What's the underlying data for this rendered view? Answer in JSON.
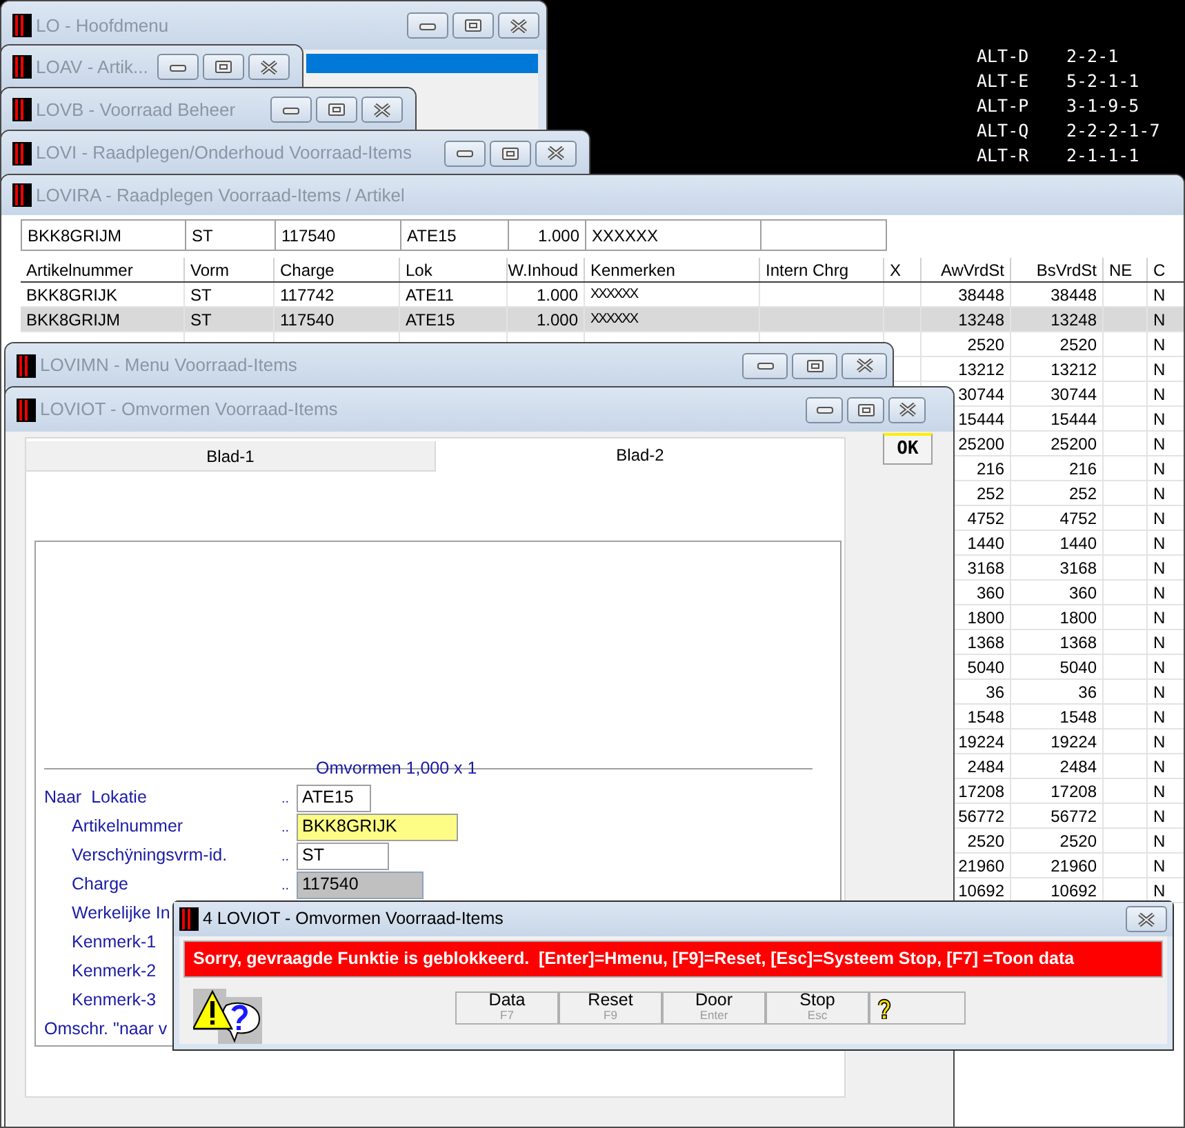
{
  "desktop": {
    "shortcuts": [
      {
        "key": "ALT-D",
        "code": "2-2-1"
      },
      {
        "key": "ALT-E",
        "code": "5-2-1-1"
      },
      {
        "key": "ALT-P",
        "code": "3-1-9-5"
      },
      {
        "key": "ALT-Q",
        "code": "2-2-2-1-7"
      },
      {
        "key": "ALT-R",
        "code": "2-1-1-1"
      }
    ]
  },
  "windows": [
    {
      "title": "LO - Hoofdmenu",
      "controls": true
    },
    {
      "title": "LOAV - Artik...",
      "controls": true
    },
    {
      "title": "LOVB - Voorraad Beheer",
      "controls": true
    },
    {
      "title": "LOVI - Raadplegen/Onderhoud Voorraad-Items",
      "controls": true
    },
    {
      "title": "LOVIRA - Raadplegen Voorraad-Items / Artikel",
      "controls": false
    },
    {
      "title": "LOVIMN - Menu Voorraad-Items",
      "controls": true
    },
    {
      "title": "LOVIOT - Omvormen Voorraad-Items",
      "controls": true
    }
  ],
  "lovira": {
    "filter_row": [
      "BKK8GRIJM",
      "ST",
      "117540",
      "ATE15",
      "1.000",
      "XXXXXX"
    ],
    "columns": [
      "Artikelnummer",
      "Vorm",
      "Charge",
      "Lok",
      "W.Inhoud",
      "Kenmerken",
      "Intern Chrg",
      "X",
      "AwVrdSt",
      "BsVrdSt",
      "NE",
      "C"
    ],
    "rows": [
      {
        "selected": false,
        "cells": {
          "artikelnummer": "BKK8GRIJK",
          "vorm": "ST",
          "charge": "117742",
          "lok": "ATE11",
          "w_inhoud": "1.000",
          "kenmerken": "XXXXXX",
          "aw_vrd_st": "38448",
          "bs_vrd_st": "38448",
          "c": "N"
        }
      },
      {
        "selected": true,
        "cells": {
          "artikelnummer": "BKK8GRIJM",
          "vorm": "ST",
          "charge": "117540",
          "lok": "ATE15",
          "w_inhoud": "1.000",
          "kenmerken": "XXXXXX",
          "aw_vrd_st": "13248",
          "bs_vrd_st": "13248",
          "c": "N"
        }
      },
      {
        "selected": false,
        "cells": {
          "aw_vrd_st": "2520",
          "bs_vrd_st": "2520",
          "c": "N"
        }
      },
      {
        "selected": false,
        "cells": {
          "aw_vrd_st": "13212",
          "bs_vrd_st": "13212",
          "c": "N"
        }
      },
      {
        "selected": false,
        "cells": {
          "aw_vrd_st": "30744",
          "bs_vrd_st": "30744",
          "c": "N"
        }
      },
      {
        "selected": false,
        "cells": {
          "aw_vrd_st": "15444",
          "bs_vrd_st": "15444",
          "c": "N"
        }
      },
      {
        "selected": false,
        "cells": {
          "aw_vrd_st": "25200",
          "bs_vrd_st": "25200",
          "c": "N"
        }
      },
      {
        "selected": false,
        "cells": {
          "aw_vrd_st": "216",
          "bs_vrd_st": "216",
          "c": "N"
        }
      },
      {
        "selected": false,
        "cells": {
          "aw_vrd_st": "252",
          "bs_vrd_st": "252",
          "c": "N"
        }
      },
      {
        "selected": false,
        "cells": {
          "aw_vrd_st": "4752",
          "bs_vrd_st": "4752",
          "c": "N"
        }
      },
      {
        "selected": false,
        "cells": {
          "aw_vrd_st": "1440",
          "bs_vrd_st": "1440",
          "c": "N"
        }
      },
      {
        "selected": false,
        "cells": {
          "aw_vrd_st": "3168",
          "bs_vrd_st": "3168",
          "c": "N"
        }
      },
      {
        "selected": false,
        "cells": {
          "aw_vrd_st": "360",
          "bs_vrd_st": "360",
          "c": "N"
        }
      },
      {
        "selected": false,
        "cells": {
          "aw_vrd_st": "1800",
          "bs_vrd_st": "1800",
          "c": "N"
        }
      },
      {
        "selected": false,
        "cells": {
          "aw_vrd_st": "1368",
          "bs_vrd_st": "1368",
          "c": "N"
        }
      },
      {
        "selected": false,
        "cells": {
          "aw_vrd_st": "5040",
          "bs_vrd_st": "5040",
          "c": "N"
        }
      },
      {
        "selected": false,
        "cells": {
          "aw_vrd_st": "36",
          "bs_vrd_st": "36",
          "c": "N"
        }
      },
      {
        "selected": false,
        "cells": {
          "aw_vrd_st": "1548",
          "bs_vrd_st": "1548",
          "c": "N"
        }
      },
      {
        "selected": false,
        "cells": {
          "aw_vrd_st": "19224",
          "bs_vrd_st": "19224",
          "c": "N"
        }
      },
      {
        "selected": false,
        "cells": {
          "aw_vrd_st": "2484",
          "bs_vrd_st": "2484",
          "c": "N"
        }
      },
      {
        "selected": false,
        "cells": {
          "aw_vrd_st": "17208",
          "bs_vrd_st": "17208",
          "c": "N"
        }
      },
      {
        "selected": false,
        "cells": {
          "aw_vrd_st": "56772",
          "bs_vrd_st": "56772",
          "c": "N"
        }
      },
      {
        "selected": false,
        "cells": {
          "aw_vrd_st": "2520",
          "bs_vrd_st": "2520",
          "c": "N"
        }
      },
      {
        "selected": false,
        "cells": {
          "aw_vrd_st": "21960",
          "bs_vrd_st": "21960",
          "c": "N"
        }
      },
      {
        "selected": false,
        "cells": {
          "aw_vrd_st": "10692",
          "bs_vrd_st": "10692",
          "c": "N"
        }
      }
    ]
  },
  "loviot": {
    "tabs": [
      {
        "label": "Blad-1",
        "selected": false
      },
      {
        "label": "Blad-2",
        "selected": true
      }
    ],
    "ok_button": "OK",
    "section_title": "Omvormen 1,000 x 1",
    "form": [
      {
        "kind": "field",
        "prefix": "Naar",
        "label": "Lokatie",
        "leader": "..",
        "value": "ATE15",
        "focused": false,
        "readonly": false
      },
      {
        "kind": "field",
        "label": "Artikelnummer",
        "leader": "..",
        "value": "BKK8GRIJK",
        "focused": true,
        "readonly": false
      },
      {
        "kind": "field",
        "label": "Verschÿningsvrm-id.",
        "leader": "..",
        "value": "ST",
        "focused": false,
        "readonly": false
      },
      {
        "kind": "field",
        "label": "Charge",
        "leader": "..",
        "value": "117540",
        "focused": false,
        "readonly": true
      },
      {
        "kind": "label",
        "label": "Werkelijke In"
      },
      {
        "kind": "label",
        "label": "Kenmerk-1"
      },
      {
        "kind": "label",
        "label": "Kenmerk-2"
      },
      {
        "kind": "label",
        "label": "Kenmerk-3"
      },
      {
        "kind": "note",
        "label": "Omschr. \"naar v"
      }
    ]
  },
  "dialog": {
    "title": "4 LOVIOT - Omvormen Voorraad-Items",
    "message": "Sorry, gevraagde Funktie is geblokkeerd.  [Enter]=Hmenu, [F9]=Reset, [Esc]=Systeem Stop, [F7] =Toon data",
    "buttons": [
      {
        "kind": "text",
        "label": "Data",
        "shortcut": "F7"
      },
      {
        "kind": "text",
        "label": "Reset",
        "shortcut": "F9"
      },
      {
        "kind": "text",
        "label": "Door",
        "shortcut": "Enter"
      },
      {
        "kind": "text",
        "label": "Stop",
        "shortcut": "Esc"
      },
      {
        "kind": "help"
      }
    ]
  }
}
